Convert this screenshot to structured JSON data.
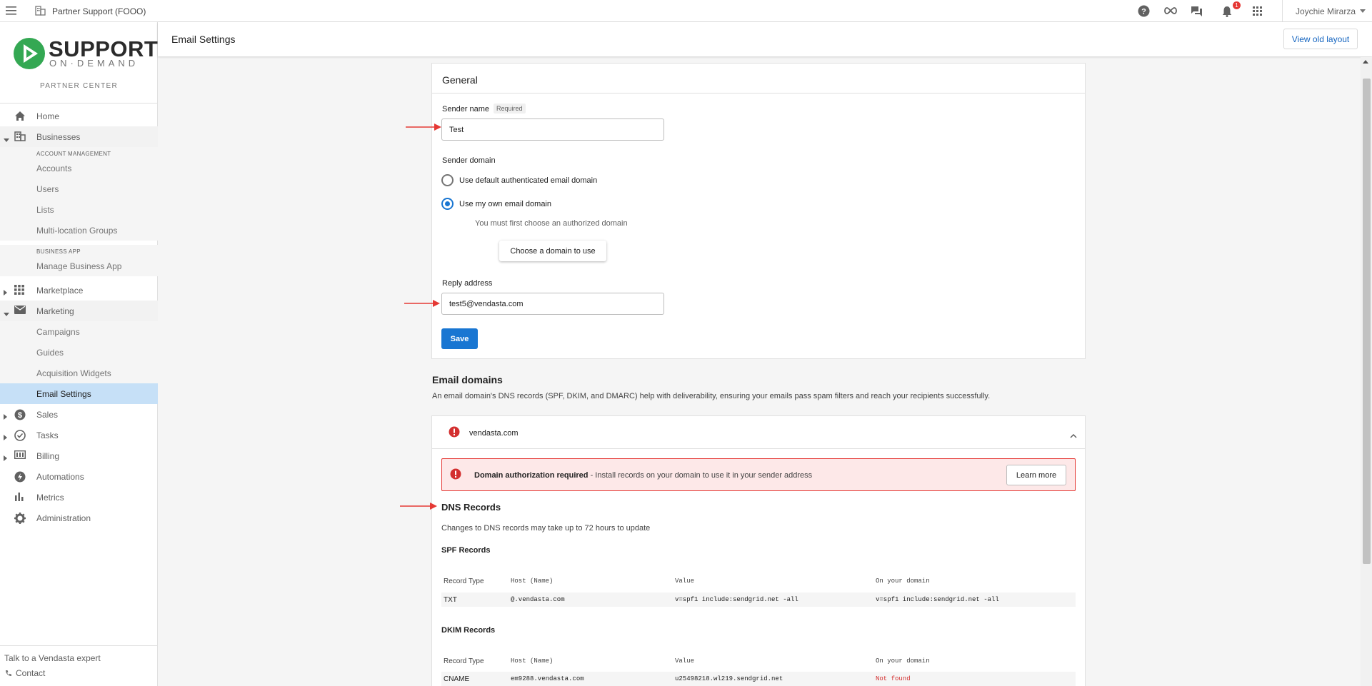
{
  "topbar": {
    "partner_name": "Partner Support (FOOO)",
    "notification_count": "1",
    "user_name": "Joychie Mirarza",
    "icons": [
      "menu-icon",
      "building-icon",
      "help-icon",
      "infinity-icon",
      "chat-icon",
      "bell-icon",
      "apps-grid-icon",
      "chevron-down-icon"
    ]
  },
  "sidebar": {
    "logo_main": "SUPPORT",
    "logo_sub": "ON·DEMAND",
    "partner_center": "PARTNER CENTER",
    "nav": {
      "home": "Home",
      "businesses": "Businesses",
      "account_management": "ACCOUNT MANAGEMENT",
      "accounts": "Accounts",
      "users": "Users",
      "lists": "Lists",
      "multi_location": "Multi-location Groups",
      "business_app": "BUSINESS APP",
      "manage_business_app": "Manage Business App",
      "marketplace": "Marketplace",
      "marketing": "Marketing",
      "campaigns": "Campaigns",
      "guides": "Guides",
      "acquisition_widgets": "Acquisition Widgets",
      "email_settings": "Email Settings",
      "sales": "Sales",
      "tasks": "Tasks",
      "billing": "Billing",
      "automations": "Automations",
      "metrics": "Metrics",
      "administration": "Administration"
    },
    "footer": {
      "talk": "Talk to a Vendasta expert",
      "contact": "Contact"
    }
  },
  "header": {
    "title": "Email Settings",
    "old_layout_button": "View old layout"
  },
  "general": {
    "title": "General",
    "sender_name_label": "Sender name",
    "required_tag": "Required",
    "sender_name_value": "Test",
    "sender_domain_label": "Sender domain",
    "option_default": "Use default authenticated email domain",
    "option_own": "Use my own email domain",
    "selected_option": "own",
    "domain_note": "You must first choose an authorized domain",
    "choose_domain_button": "Choose a domain to use",
    "reply_address_label": "Reply address",
    "reply_address_value": "test5@vendasta.com",
    "save_button": "Save"
  },
  "email_domains": {
    "title": "Email domains",
    "description": "An email domain's DNS records (SPF, DKIM, and DMARC) help with deliverability, ensuring your emails pass spam filters and reach your recipients successfully.",
    "domain": "vendasta.com",
    "alert_title": "Domain authorization required",
    "alert_text": " - Install records on your domain to use it in your sender address",
    "learn_more_button": "Learn more",
    "dns_title": "DNS Records",
    "dns_note": "Changes to DNS records may take up to 72 hours to update",
    "columns": [
      "Record Type",
      "Host (Name)",
      "Value",
      "On your domain"
    ],
    "spf": {
      "title": "SPF Records",
      "rows": [
        {
          "type": "TXT",
          "host": "@.vendasta.com",
          "value": "v=spf1 include:sendgrid.net -all",
          "on_domain": "v=spf1 include:sendgrid.net -all"
        }
      ]
    },
    "dkim": {
      "title": "DKIM Records",
      "rows": [
        {
          "type": "CNAME",
          "host": "em9288.vendasta.com",
          "value": "u25498218.wl219.sendgrid.net",
          "on_domain": "Not found"
        }
      ]
    }
  },
  "colors": {
    "accent": "#1976d2",
    "active_nav": "#c6e0f7",
    "error": "#d32f2f",
    "alert_bg": "#fde8e8",
    "annotation_arrow": "#e53935",
    "logo_green": "#34a853"
  }
}
